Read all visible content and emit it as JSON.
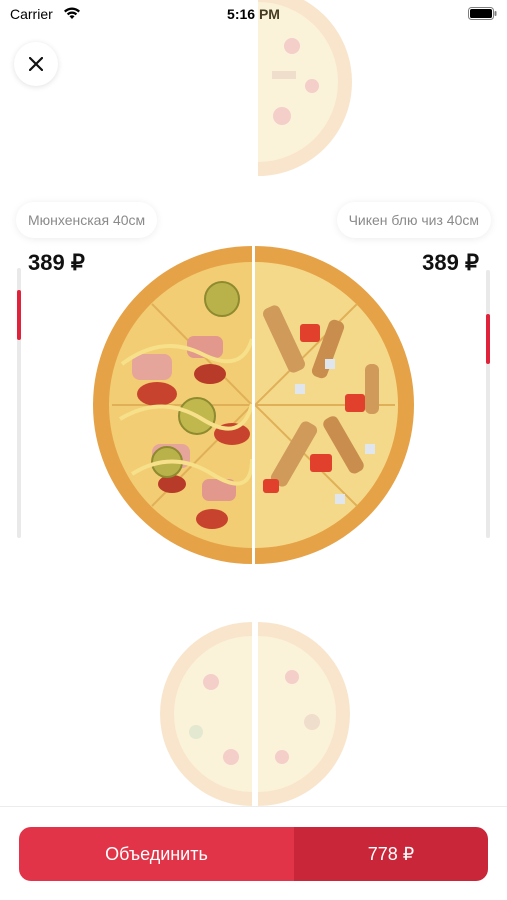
{
  "status_bar": {
    "carrier": "Carrier",
    "time": "5:16 PM"
  },
  "left_pizza": {
    "name": "Мюнхенская 40см",
    "price": "389 ₽",
    "scroll_progress": 0.1
  },
  "right_pizza": {
    "name": "Чикен блю чиз 40см",
    "price": "389 ₽",
    "scroll_progress": 0.2
  },
  "cta": {
    "label": "Объединить",
    "total": "778 ₽"
  },
  "colors": {
    "accent": "#e13448",
    "accent_dark": "#c92639",
    "crust": "#e8a54a",
    "cheese": "#f4d37c"
  },
  "icons": {
    "close": "close-icon",
    "wifi": "wifi-icon",
    "battery": "battery-icon"
  }
}
